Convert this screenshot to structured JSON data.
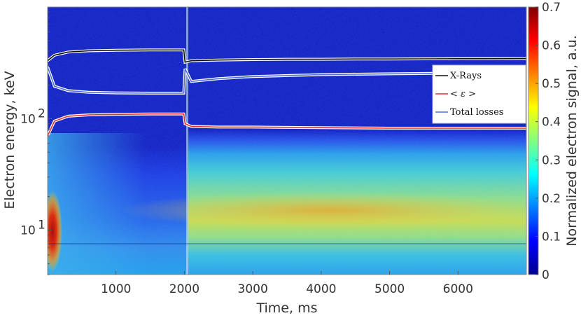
{
  "chart_data": {
    "type": "heatmap",
    "xlabel": "Time, ms",
    "ylabel": "Electron energy, keV",
    "colorbar_label": "Normalized electron signal, a.u.",
    "xlim": [
      0,
      7000
    ],
    "ylim": [
      4,
      1000
    ],
    "yscale": "log",
    "x_ticks": [
      1000,
      2000,
      3000,
      4000,
      5000,
      6000
    ],
    "x_tick_labels": [
      "1000",
      "2000",
      "3000",
      "4000",
      "5000",
      "6000"
    ],
    "y_ticks": [
      10,
      100
    ],
    "y_tick_labels": [
      "10",
      "10"
    ],
    "y_tick_exponent": "1",
    "y_tick_exponent_2": "2",
    "colorbar_range": [
      0,
      0.7
    ],
    "colorbar_ticks": [
      0,
      0.1,
      0.2,
      0.3,
      0.4,
      0.5,
      0.6,
      0.7
    ],
    "colorbar_tick_labels": [
      "0",
      "0.1",
      "0.2",
      "0.3",
      "0.4",
      "0.5",
      "0.6",
      "0.7"
    ],
    "colormap": "jet",
    "grid": false,
    "legend_position": "right",
    "series": [
      {
        "name": "X-Rays",
        "color": "#111111",
        "x": [
          0,
          100,
          300,
          600,
          1000,
          1500,
          1990,
          2010,
          2100,
          2500,
          3000,
          3500,
          4000,
          4500,
          5000,
          5500,
          6000,
          6500,
          7000
        ],
        "y": [
          330,
          370,
          395,
          405,
          410,
          412,
          412,
          320,
          330,
          335,
          338,
          340,
          340,
          342,
          342,
          343,
          344,
          344,
          345
        ]
      },
      {
        "name": "< ε >",
        "color": "#e53030",
        "x": [
          0,
          100,
          300,
          600,
          1000,
          1500,
          1990,
          2010,
          2100,
          2500,
          3000,
          4000,
          5000,
          6000,
          7000
        ],
        "y": [
          70,
          95,
          105,
          108,
          109,
          110,
          110,
          90,
          85,
          84,
          84,
          83,
          82,
          82,
          82
        ]
      },
      {
        "name": "Total losses",
        "color": "#5070e0",
        "x": [
          0,
          100,
          300,
          600,
          1000,
          1500,
          1990,
          2010,
          2100,
          2500,
          3000,
          4000,
          5000,
          6000,
          7000
        ],
        "y": [
          290,
          195,
          178,
          172,
          170,
          169,
          169,
          280,
          215,
          228,
          238,
          248,
          252,
          255,
          256
        ]
      }
    ]
  }
}
